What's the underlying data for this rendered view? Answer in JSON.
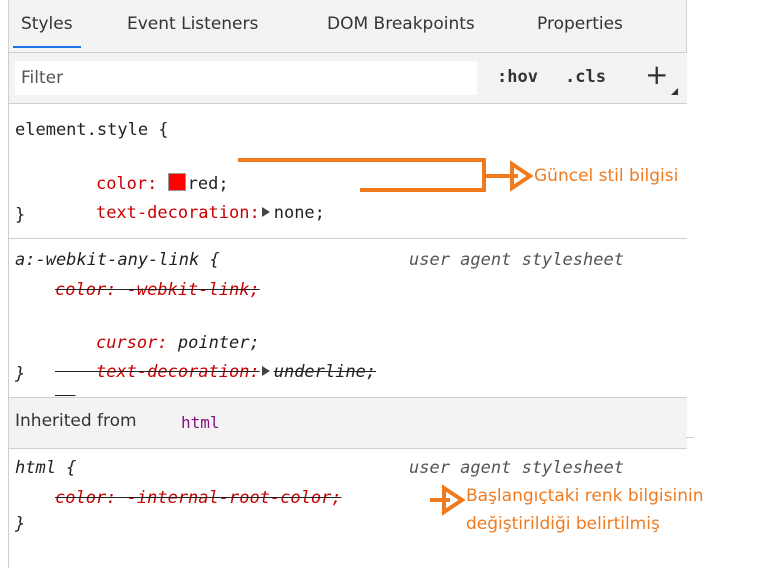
{
  "tabs": [
    "Styles",
    "Event Listeners",
    "DOM Breakpoints",
    "Properties"
  ],
  "filter": {
    "placeholder": "Filter",
    "hov": ":hov",
    "cls": ".cls",
    "plus": "+"
  },
  "element_style": {
    "selector": "element.style {",
    "color_prop": "color:",
    "color_val": "red;",
    "td_prop": "text-decoration:",
    "td_val": "none;",
    "close": "}"
  },
  "ua_rule": {
    "selector": "a:-webkit-any-link {",
    "source": "user agent stylesheet",
    "color_line": "color: -webkit-link;",
    "cursor_prop": "cursor:",
    "cursor_val": "pointer;",
    "td_prop": "text-decoration:",
    "td_val": "underline;",
    "close": "}"
  },
  "inherited": {
    "label": "Inherited from",
    "tag": "html"
  },
  "html_rule": {
    "selector": "html {",
    "source": "user agent stylesheet",
    "color_line": "color: -internal-root-color;",
    "close": "}"
  },
  "annotations": {
    "current": "Güncel stil bilgisi",
    "overridden_line1": "Başlangıçtaki renk bilgisinin",
    "overridden_line2": "değiştirildiği belirtilmiş"
  },
  "colors": {
    "annotation": "#f07a1e",
    "property": "#c80000",
    "swatch": "#ff0000"
  }
}
